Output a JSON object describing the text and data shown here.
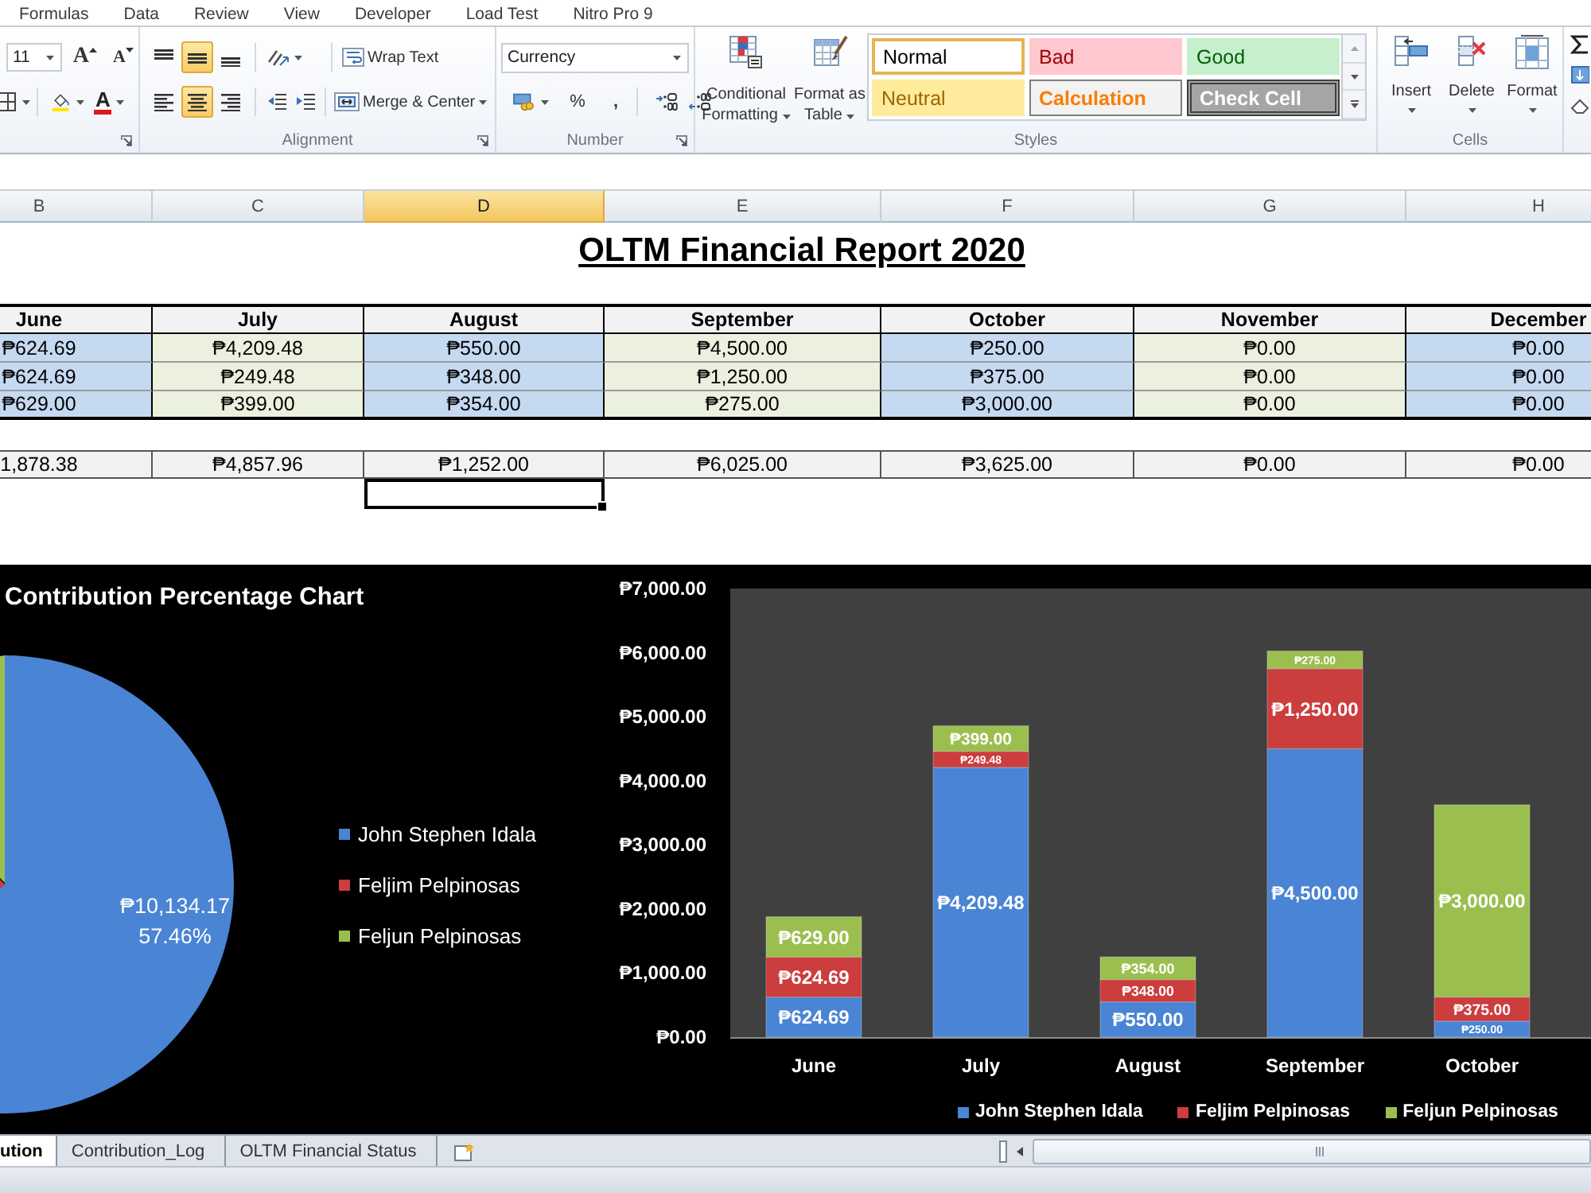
{
  "menu_tabs": [
    {
      "label": "Formulas",
      "selected": false
    },
    {
      "label": "Data",
      "selected": false
    },
    {
      "label": "Review",
      "selected": false
    },
    {
      "label": "View",
      "selected": false
    },
    {
      "label": "Developer",
      "selected": false
    },
    {
      "label": "Load Test",
      "selected": false
    },
    {
      "label": "Nitro Pro 9",
      "selected": false
    }
  ],
  "ribbon": {
    "font": {
      "size": "11",
      "grow_button": "A",
      "shrink_button": "A",
      "font_color_button": "A"
    },
    "alignment": {
      "label": "Alignment",
      "vertical": [
        {
          "kind": "top",
          "selected": false
        },
        {
          "kind": "middle",
          "selected": true
        },
        {
          "kind": "bottom",
          "selected": false
        }
      ],
      "horizontal": [
        {
          "kind": "left",
          "selected": false
        },
        {
          "kind": "center",
          "selected": true
        },
        {
          "kind": "right",
          "selected": false
        }
      ],
      "wrap_text": "Wrap Text",
      "merge_center": "Merge & Center"
    },
    "number": {
      "label": "Number",
      "format": "Currency",
      "percent_button": "%",
      "comma_button": ","
    },
    "styles": {
      "label": "Styles",
      "conditional_formatting": [
        "Conditional",
        "Formatting"
      ],
      "format_as_table": [
        "Format as",
        "Table"
      ],
      "gallery": [
        {
          "label": "Normal",
          "kind": "normal",
          "selected": true
        },
        {
          "label": "Bad",
          "kind": "bad",
          "selected": false
        },
        {
          "label": "Good",
          "kind": "good",
          "selected": false
        },
        {
          "label": "Neutral",
          "kind": "neutral",
          "selected": false
        },
        {
          "label": "Calculation",
          "kind": "calculation",
          "selected": false
        },
        {
          "label": "Check Cell",
          "kind": "check",
          "selected": false
        }
      ]
    },
    "cells": {
      "label": "Cells",
      "buttons": [
        {
          "label": "Insert",
          "kind": "insert"
        },
        {
          "label": "Delete",
          "kind": "delete"
        },
        {
          "label": "Format",
          "kind": "format"
        }
      ]
    }
  },
  "sheet": {
    "columns": [
      {
        "label": "B",
        "selected": false
      },
      {
        "label": "C",
        "selected": false
      },
      {
        "label": "D",
        "selected": true
      },
      {
        "label": "E",
        "selected": false
      },
      {
        "label": "F",
        "selected": false
      },
      {
        "label": "G",
        "selected": false
      },
      {
        "label": "H",
        "selected": false
      }
    ],
    "title": "OLTM Financial Report 2020",
    "months": [
      "June",
      "July",
      "August",
      "September",
      "October",
      "November",
      "December"
    ],
    "rows": [
      [
        "₱624.69",
        "₱4,209.48",
        "₱550.00",
        "₱4,500.00",
        "₱250.00",
        "₱0.00",
        "₱0.00"
      ],
      [
        "₱624.69",
        "₱249.48",
        "₱348.00",
        "₱1,250.00",
        "₱375.00",
        "₱0.00",
        "₱0.00"
      ],
      [
        "₱629.00",
        "₱399.00",
        "₱354.00",
        "₱275.00",
        "₱3,000.00",
        "₱0.00",
        "₱0.00"
      ]
    ],
    "totals": [
      "1,878.38",
      "₱4,857.96",
      "₱1,252.00",
      "₱6,025.00",
      "₱3,625.00",
      "₱0.00",
      "₱0.00"
    ],
    "cursor_row": [
      {
        "selected": false
      },
      {
        "selected": false
      },
      {
        "selected": true
      },
      {
        "selected": false
      },
      {
        "selected": false
      },
      {
        "selected": false
      },
      {
        "selected": false
      }
    ]
  },
  "charts": {
    "pie": {
      "title": "Contribution Percentage Chart",
      "slice_value": "₱10,134.17",
      "slice_percent": "57.46%",
      "legend": [
        {
          "label": "John Stephen Idala",
          "color": "#4a84d4"
        },
        {
          "label": "Feljim Pelpinosas",
          "color": "#cc3d3d"
        },
        {
          "label": "Feljun Pelpinosas",
          "color": "#9bbf4f"
        }
      ]
    },
    "bar": {
      "chart_data": {
        "type": "bar",
        "stacked": true,
        "legend": "bottom",
        "categories": [
          "June",
          "July",
          "August",
          "September",
          "October"
        ],
        "series": [
          {
            "name": "John Stephen Idala",
            "color": "#4a84d4",
            "values": [
              624.69,
              4209.48,
              550,
              4500,
              250
            ],
            "value_labels": [
              "₱624.69",
              "₱4,209.48",
              "₱550.00",
              "₱4,500.00",
              "₱250.00"
            ]
          },
          {
            "name": "Feljim Pelpinosas",
            "color": "#cc3d3d",
            "values": [
              624.69,
              249.48,
              348,
              1250,
              375
            ],
            "value_labels": [
              "₱624.69",
              "₱249.48",
              "₱348.00",
              "₱1,250.00",
              "₱375.00"
            ]
          },
          {
            "name": "Feljun Pelpinosas",
            "color": "#9bbf4f",
            "values": [
              629,
              399,
              354,
              275,
              3000
            ],
            "value_labels": [
              "₱629.00",
              "₱399.00",
              "₱354.00",
              "₱275.00",
              "₱3,000.00"
            ]
          }
        ],
        "ylim": [
          0,
          7000
        ],
        "yticks": [
          {
            "value": 0,
            "label": "₱0.00"
          },
          {
            "value": 1000,
            "label": "₱1,000.00"
          },
          {
            "value": 2000,
            "label": "₱2,000.00"
          },
          {
            "value": 3000,
            "label": "₱3,000.00"
          },
          {
            "value": 4000,
            "label": "₱4,000.00"
          },
          {
            "value": 5000,
            "label": "₱5,000.00"
          },
          {
            "value": 6000,
            "label": "₱6,000.00"
          },
          {
            "value": 7000,
            "label": "₱7,000.00"
          }
        ]
      }
    }
  },
  "sheet_tabs": [
    {
      "label": "ution",
      "selected": true
    },
    {
      "label": "Contribution_Log",
      "selected": false
    },
    {
      "label": "OLTM Financial Status",
      "selected": false
    }
  ]
}
